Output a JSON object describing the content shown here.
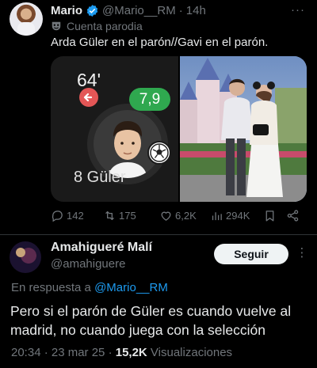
{
  "tweet": {
    "author_name": "Mario",
    "handle": "@Mario__RM",
    "separator": "·",
    "time": "14h",
    "parody_label": "Cuenta parodia",
    "text": "Arda Güler en el parón//Gavi en el parón.",
    "media": {
      "left": {
        "minute": "64'",
        "rating": "7,9",
        "player_number_name": "8 Güler"
      }
    },
    "actions": {
      "replies": "142",
      "reposts": "175",
      "likes": "6,2K",
      "views": "294K"
    }
  },
  "reply": {
    "author_name": "Amahigueré Malí",
    "handle": "@amahiguere",
    "follow_label": "Seguir",
    "in_reply_prefix": "En respuesta a ",
    "in_reply_mention": "@Mario__RM",
    "text": "Pero si el parón de Güler es cuando vuelve al madrid, no cuando juega con la selección",
    "timestamp": "20:34 · 23 mar 25 · ",
    "views_count": "15,2K",
    "views_label": " Visualizaciones"
  },
  "colors": {
    "background": "#000000",
    "primary_text": "#e7e9ea",
    "secondary_text": "#71767b",
    "link": "#1d9bf0",
    "verified": "#1d9bf0",
    "rating_badge": "#2fa84f",
    "sub_off_badge": "#e35656"
  },
  "icons": [
    "verified-badge-icon",
    "parody-mask-icon",
    "more-icon",
    "reply-icon",
    "repost-icon",
    "like-icon",
    "views-icon",
    "bookmark-icon",
    "share-icon",
    "substitution-arrow-icon",
    "football-icon"
  ]
}
